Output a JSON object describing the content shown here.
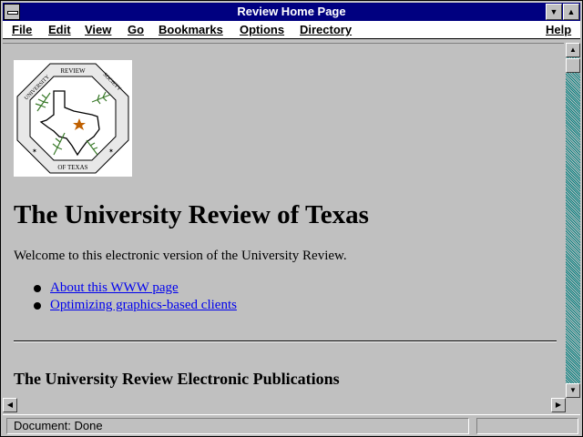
{
  "window": {
    "title": "Review Home Page"
  },
  "menubar": {
    "items": [
      {
        "label": "File"
      },
      {
        "label": "Edit"
      },
      {
        "label": "View"
      },
      {
        "label": "Go"
      },
      {
        "label": "Bookmarks"
      },
      {
        "label": "Options"
      },
      {
        "label": "Directory"
      },
      {
        "label": "Help"
      }
    ]
  },
  "page": {
    "logo": {
      "top_text": "REVIEW",
      "left_text": "UNIVERSITY",
      "right_text": "SOCIETY",
      "bottom_text": "OF TEXAS"
    },
    "heading": "The University Review of Texas",
    "welcome": "Welcome to this electronic version of the University Review.",
    "links": [
      {
        "label": "About this WWW page"
      },
      {
        "label": "Optimizing graphics-based clients"
      }
    ],
    "section_heading": "The University Review Electronic Publications"
  },
  "statusbar": {
    "text": "Document: Done"
  },
  "colors": {
    "titlebar": "#000080",
    "link": "#0000ee",
    "background": "#c0c0c0",
    "scroll_track": "#008080"
  },
  "icons": {
    "system_menu": "system-menu-icon",
    "minimize": "minimize-icon",
    "maximize": "maximize-icon",
    "scroll_up": "arrow-up-icon",
    "scroll_down": "arrow-down-icon",
    "scroll_left": "arrow-left-icon",
    "scroll_right": "arrow-right-icon"
  }
}
